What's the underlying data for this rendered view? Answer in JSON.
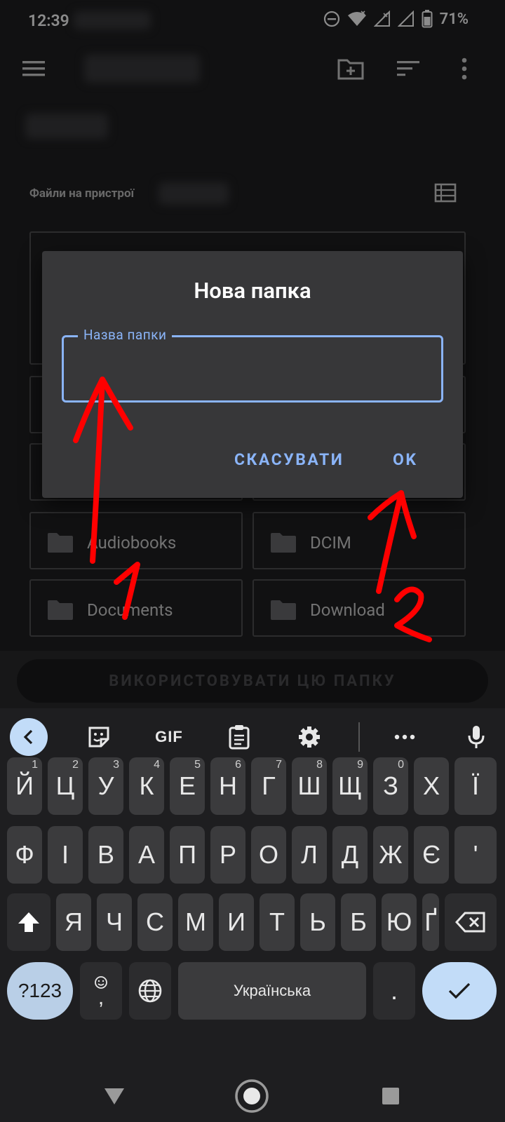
{
  "status_bar": {
    "time": "12:39",
    "battery": "71%"
  },
  "app_bar": {
    "icons": [
      "menu-icon",
      "new-folder-icon",
      "sort-icon",
      "more-vert-icon"
    ]
  },
  "files": {
    "section_label": "Файли на пристрої",
    "folders": [
      {
        "name": "Audiobooks"
      },
      {
        "name": "DCIM"
      },
      {
        "name": "Documents"
      },
      {
        "name": "Download"
      }
    ]
  },
  "dialog": {
    "title": "Нова папка",
    "field_label": "Назва папки",
    "field_value": "",
    "cancel_label": "СКАСУВАТИ",
    "ok_label": "OK"
  },
  "use_folder_button": "ВИКОРИСТОВУВАТИ ЦЮ ПАПКУ",
  "keyboard": {
    "toolbar": {
      "gif_label": "GIF"
    },
    "row1": [
      {
        "key": "Й",
        "hint": "1"
      },
      {
        "key": "Ц",
        "hint": "2"
      },
      {
        "key": "У",
        "hint": "3"
      },
      {
        "key": "К",
        "hint": "4"
      },
      {
        "key": "Е",
        "hint": "5"
      },
      {
        "key": "Н",
        "hint": "6"
      },
      {
        "key": "Г",
        "hint": "7"
      },
      {
        "key": "Ш",
        "hint": "8"
      },
      {
        "key": "Щ",
        "hint": "9"
      },
      {
        "key": "З",
        "hint": "0"
      },
      {
        "key": "Х",
        "hint": ""
      },
      {
        "key": "Ї",
        "hint": ""
      }
    ],
    "row2": [
      "Ф",
      "І",
      "В",
      "А",
      "П",
      "Р",
      "О",
      "Л",
      "Д",
      "Ж",
      "Є",
      "'"
    ],
    "row3": [
      "Я",
      "Ч",
      "С",
      "М",
      "И",
      "Т",
      "Ь",
      "Б",
      "Ю",
      "Ґ"
    ],
    "symbols_label": "?123",
    "comma_label": ",",
    "space_label": "Українська",
    "period_label": "."
  },
  "annotations": {
    "label_1": "1",
    "label_2": "2",
    "color": "#ff0000"
  },
  "colors": {
    "accent": "#8ab4f8",
    "dialog_bg": "#373739",
    "background": "#1f1f21"
  }
}
